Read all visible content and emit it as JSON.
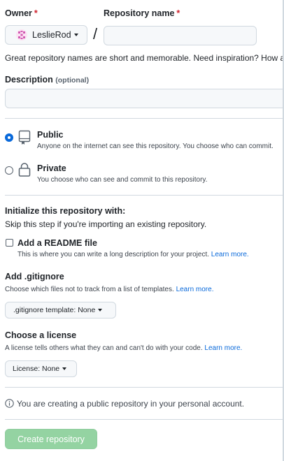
{
  "owner": {
    "label": "Owner",
    "required_mark": "*",
    "selected": "LeslieRod"
  },
  "repo_name": {
    "label": "Repository name",
    "required_mark": "*",
    "value": ""
  },
  "separator": "/",
  "hint": "Great repository names are short and memorable. Need inspiration? How about",
  "description": {
    "label": "Description",
    "optional": "(optional)",
    "value": ""
  },
  "visibility": {
    "selected": "public",
    "options": [
      {
        "title": "Public",
        "desc": "Anyone on the internet can see this repository. You choose who can commit."
      },
      {
        "title": "Private",
        "desc": "You choose who can see and commit to this repository."
      }
    ]
  },
  "init": {
    "title": "Initialize this repository with:",
    "subtitle": "Skip this step if you're importing an existing repository.",
    "readme": {
      "label": "Add a README file",
      "desc": "This is where you can write a long description for your project.",
      "link": "Learn more.",
      "checked": false
    }
  },
  "gitignore": {
    "title": "Add .gitignore",
    "desc": "Choose which files not to track from a list of templates.",
    "link": "Learn more.",
    "button": ".gitignore template: None"
  },
  "license": {
    "title": "Choose a license",
    "desc": "A license tells others what they can and can't do with your code.",
    "link": "Learn more.",
    "button": "License: None"
  },
  "notice": "You are creating a public repository in your personal account.",
  "create_button": "Create repository",
  "colors": {
    "accent": "#0969da",
    "required": "#cf222e",
    "create_bg": "#94d3a2",
    "border": "#d1d9e0"
  }
}
